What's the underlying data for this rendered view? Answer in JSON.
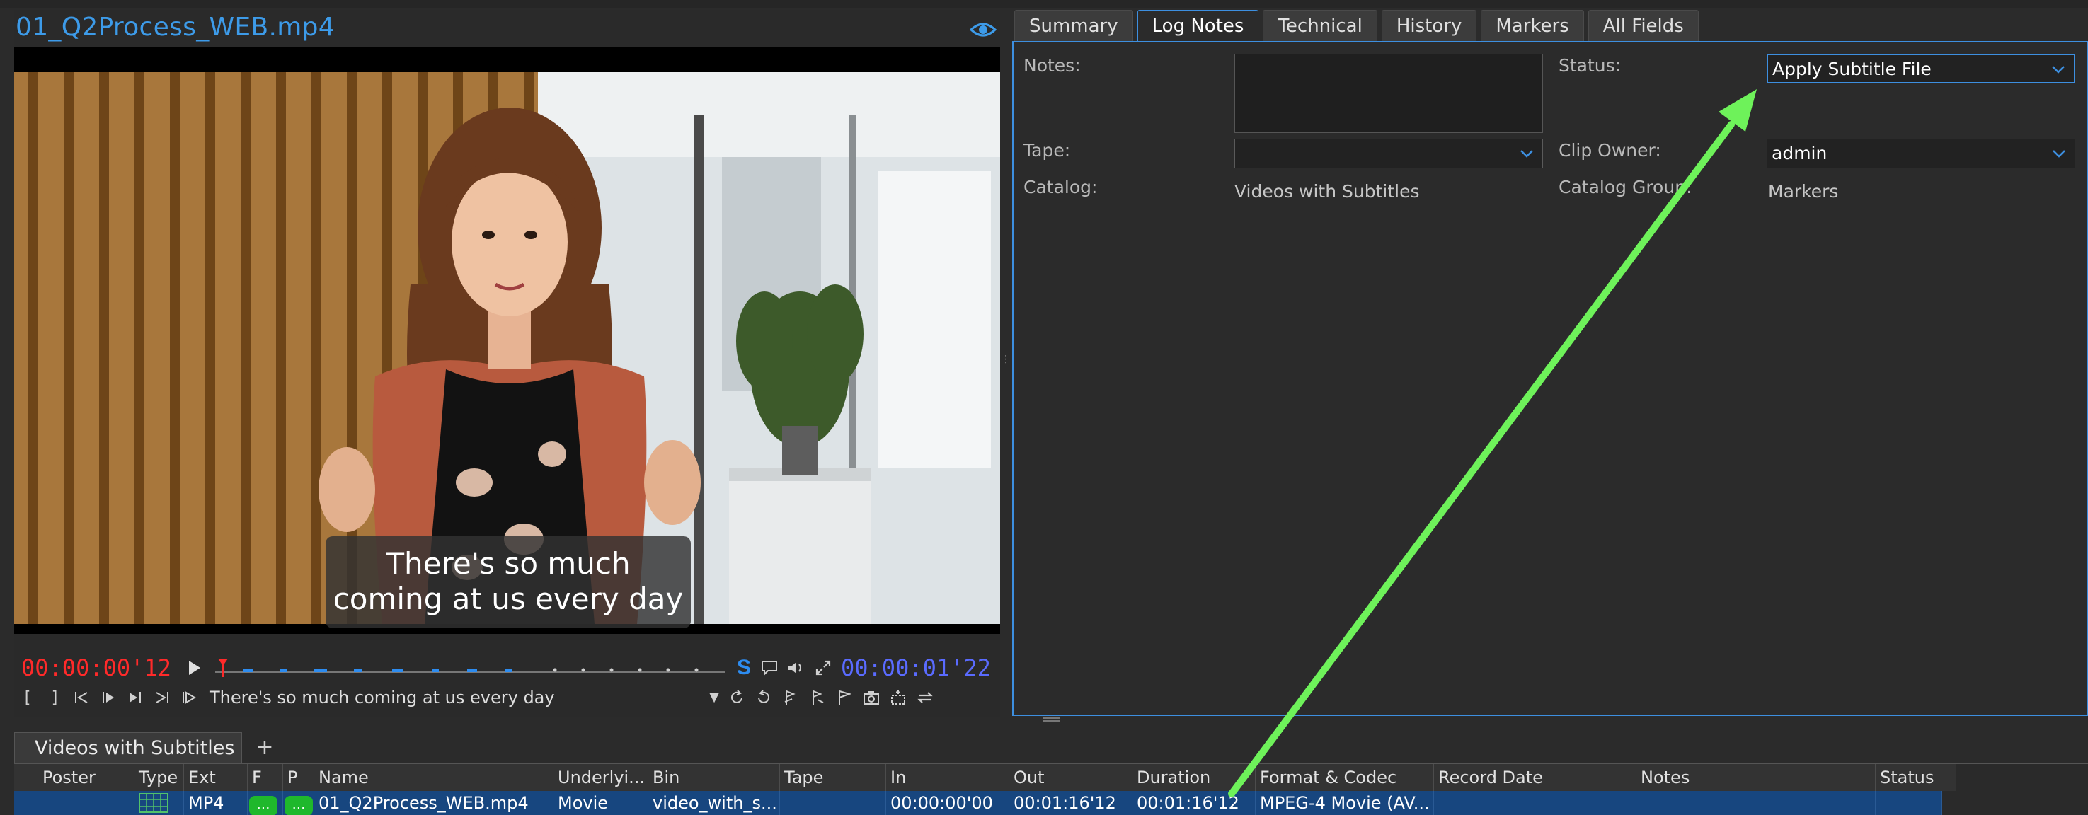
{
  "viewer": {
    "clip_title": "01_Q2Process_WEB.mp4",
    "subtitle_lines": [
      "There's so much",
      "coming at us every day"
    ],
    "timecode_current": "00:00:00'12",
    "timecode_total": "00:00:01'22",
    "subtitle_badge": "S",
    "caption_text": "There's so much coming at us every day"
  },
  "tabs": [
    "Summary",
    "Log Notes",
    "Technical",
    "History",
    "Markers",
    "All Fields"
  ],
  "active_tab": "Log Notes",
  "log_notes": {
    "notes_label": "Notes:",
    "status_label": "Status:",
    "status_value": "Apply Subtitle File",
    "tape_label": "Tape:",
    "tape_value": "",
    "clip_owner_label": "Clip Owner:",
    "clip_owner_value": "admin",
    "catalog_label": "Catalog:",
    "catalog_value": "Videos with Subtitles",
    "catalog_group_label": "Catalog Group:",
    "catalog_group_value": "Markers"
  },
  "bin": {
    "tab_label": "Videos with Subtitles",
    "add_label": "+",
    "columns": [
      "Poster",
      "Type",
      "Ext",
      "F",
      "P",
      "Name",
      "Underlyi...",
      "Bin",
      "Tape",
      "In",
      "Out",
      "Duration",
      "Format & Codec",
      "Record Date",
      "Notes",
      "Status"
    ],
    "rows": [
      {
        "poster": "",
        "type": "",
        "ext": "MP4",
        "f": "...",
        "p": "...",
        "name": "01_Q2Process_WEB.mp4",
        "underlying": "Movie",
        "bin": "video_with_s...",
        "tape": "",
        "in": "00:00:00'00",
        "out": "00:01:16'12",
        "duration": "00:01:16'12",
        "format": "MPEG-4 Movie (AV...",
        "record_date": "",
        "notes": "",
        "status": ""
      }
    ]
  },
  "colors": {
    "accent": "#3d8fe0",
    "timecode_current": "#ff2a2a",
    "timecode_total": "#5a6bff",
    "selected_row": "#17467f",
    "pill_green": "#1fb82c",
    "annotation_arrow": "#6ef25a"
  },
  "icons": [
    "eye-icon",
    "play-icon",
    "comment-icon",
    "volume-icon",
    "fullscreen-icon",
    "mark-in-icon",
    "mark-out-icon",
    "go-to-in-icon",
    "step-back-icon",
    "step-forward-icon",
    "go-to-out-icon",
    "play-in-to-out-icon",
    "loop-icon",
    "redo-icon",
    "add-marker-icon",
    "marker-out-icon",
    "flag-icon",
    "snapshot-icon",
    "effects-icon",
    "swap-icon",
    "chevron-down-icon",
    "film-icon"
  ]
}
